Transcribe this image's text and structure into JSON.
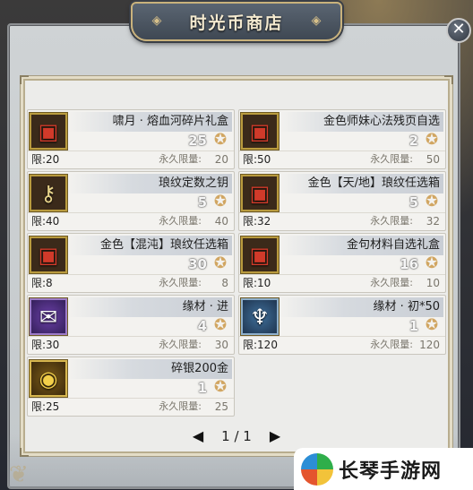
{
  "window": {
    "title": "时光币商店"
  },
  "close": {
    "glyph": "✕"
  },
  "items": [
    {
      "name": "啸月 · 熔血河碎片礼盒",
      "icon": "chest-icon",
      "price": "25",
      "limit": "限:20",
      "perm_label": "永久限量:",
      "perm_value": "20"
    },
    {
      "name": "金色师妹心法残页自选",
      "icon": "chest-icon",
      "price": "2",
      "limit": "限:50",
      "perm_label": "永久限量:",
      "perm_value": "50"
    },
    {
      "name": "琅纹定数之钥",
      "icon": "key-icon",
      "price": "5",
      "limit": "限:40",
      "perm_label": "永久限量:",
      "perm_value": "40"
    },
    {
      "name": "金色【天/地】琅纹任选箱",
      "icon": "chest-icon",
      "price": "5",
      "limit": "限:32",
      "perm_label": "永久限量:",
      "perm_value": "32"
    },
    {
      "name": "金色【混沌】琅纹任选箱",
      "icon": "chest-icon",
      "price": "30",
      "limit": "限:8",
      "perm_label": "永久限量:",
      "perm_value": "8"
    },
    {
      "name": "金句材料自选礼盒",
      "icon": "chest-icon",
      "price": "16",
      "limit": "限:10",
      "perm_label": "永久限量:",
      "perm_value": "10"
    },
    {
      "name": "缘材 · 进",
      "icon": "scroll-icon",
      "price": "4",
      "limit": "限:30",
      "perm_label": "永久限量:",
      "perm_value": "30"
    },
    {
      "name": "缘材 · 初*50",
      "icon": "rune-icon",
      "price": "1",
      "limit": "限:120",
      "perm_label": "永久限量:",
      "perm_value": "120"
    },
    {
      "name": "碎银200金",
      "icon": "coin-icon",
      "price": "1",
      "limit": "限:25",
      "perm_label": "永久限量:",
      "perm_value": "25"
    }
  ],
  "pager": {
    "prev": "◀",
    "page": "1 / 1",
    "next": "▶"
  },
  "watermark": {
    "text": "长琴手游网"
  },
  "colors": {
    "accent_gold": "#b99b3e",
    "title_bg": "#4a5462",
    "panel_bg": "#ececea"
  }
}
